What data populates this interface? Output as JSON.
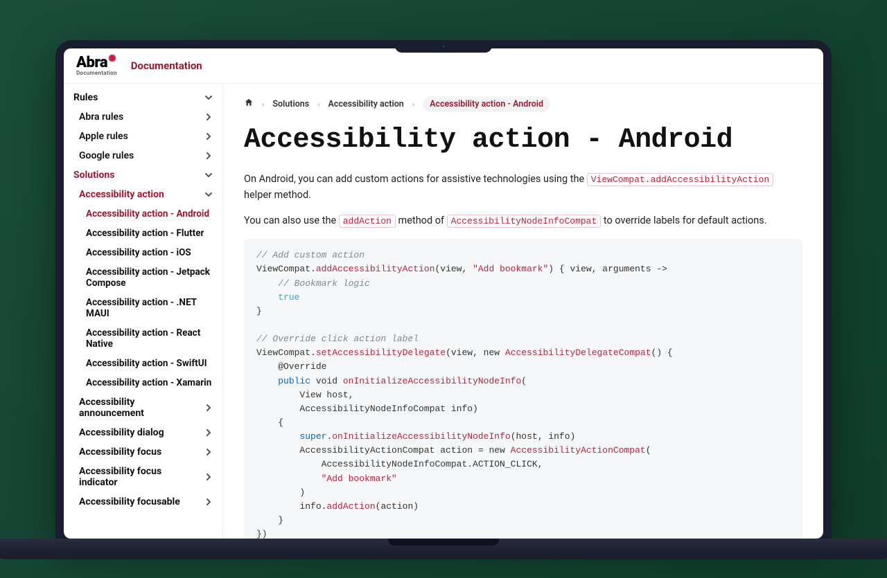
{
  "logo": {
    "main": "Abra",
    "sub": "Documentation"
  },
  "header": {
    "doc_link": "Documentation"
  },
  "sidebar": {
    "rules_label": "Rules",
    "rules_items": [
      "Abra rules",
      "Apple rules",
      "Google rules"
    ],
    "solutions_label": "Solutions",
    "accessibility_action_label": "Accessibility action",
    "accessibility_action_items": [
      "Accessibility action - Android",
      "Accessibility action - Flutter",
      "Accessibility action - iOS",
      "Accessibility action - Jetpack Compose",
      "Accessibility action - .NET MAUI",
      "Accessibility action - React Native",
      "Accessibility action - SwiftUI",
      "Accessibility action - Xamarin"
    ],
    "more_items": [
      "Accessibility announcement",
      "Accessibility dialog",
      "Accessibility focus",
      "Accessibility focus indicator",
      "Accessibility focusable"
    ]
  },
  "breadcrumb": {
    "solutions": "Solutions",
    "action": "Accessibility action",
    "current": "Accessibility action - Android"
  },
  "page_title": "Accessibility action - Android",
  "content": {
    "para1_prefix": "On Android, you can add custom actions for assistive technologies using the ",
    "para1_code": "ViewCompat.addAccessibilityAction",
    "para1_suffix": " helper method.",
    "para2_prefix": "You can also use the ",
    "para2_code1": "addAction",
    "para2_mid": " method of ",
    "para2_code2": "AccessibilityNodeInfoCompat",
    "para2_suffix": " to override labels for default actions."
  },
  "code": {
    "c1": "// Add custom action",
    "l2a": "ViewCompat.",
    "l2b": "addAccessibilityAction",
    "l2c": "(view, ",
    "l2d": "\"Add bookmark\"",
    "l2e": ") { view, arguments ->",
    "c3": "    // Bookmark logic",
    "l4a": "    ",
    "l4b": "true",
    "l5": "}",
    "c7": "// Override click action label",
    "l8a": "ViewCompat.",
    "l8b": "setAccessibilityDelegate",
    "l8c": "(view, new ",
    "l8d": "AccessibilityDelegateCompat",
    "l8e": "() {",
    "l9": "    @Override",
    "l10a": "    ",
    "l10b": "public",
    "l10c": " void ",
    "l10d": "onInitializeAccessibilityNodeInfo",
    "l10e": "(",
    "l11": "        View host,",
    "l12": "        AccessibilityNodeInfoCompat info)",
    "l13": "    {",
    "l14a": "        ",
    "l14b": "super",
    "l14c": ".",
    "l14d": "onInitializeAccessibilityNodeInfo",
    "l14e": "(host, info)",
    "l15a": "        AccessibilityActionCompat action = new ",
    "l15b": "AccessibilityActionCompat",
    "l15c": "(",
    "l16": "            AccessibilityNodeInfoCompat.ACTION_CLICK,",
    "l17a": "            ",
    "l17b": "\"Add bookmark\"",
    "l18": "        )",
    "l19a": "        info.",
    "l19b": "addAction",
    "l19c": "(action)",
    "l20": "    }",
    "l21": "})"
  }
}
